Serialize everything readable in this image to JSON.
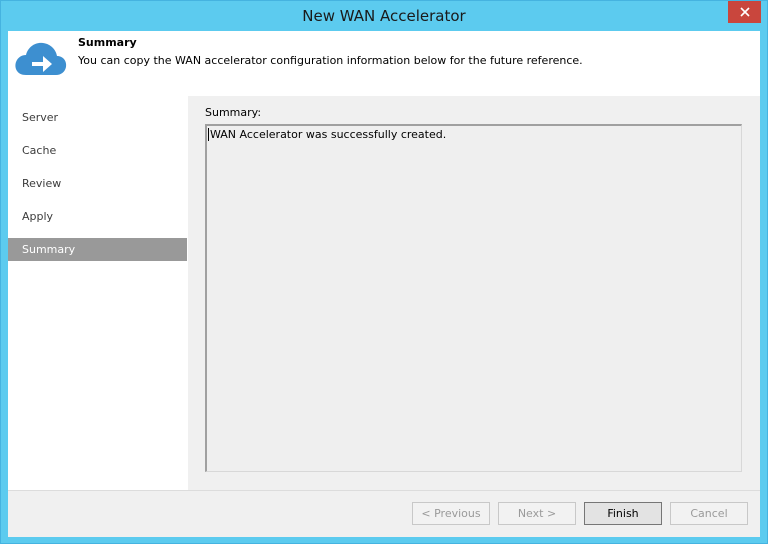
{
  "window": {
    "title": "New WAN Accelerator"
  },
  "header": {
    "icon": "cloud-arrow-icon",
    "title": "Summary",
    "description": "You can copy the WAN accelerator configuration information below for the future reference."
  },
  "nav": {
    "items": [
      {
        "label": "Server"
      },
      {
        "label": "Cache"
      },
      {
        "label": "Review"
      },
      {
        "label": "Apply"
      },
      {
        "label": "Summary",
        "active": true
      }
    ]
  },
  "content": {
    "summary_label": "Summary:",
    "summary_text": "WAN Accelerator was successfully created."
  },
  "buttons": {
    "previous": "< Previous",
    "next": "Next >",
    "finish": "Finish",
    "cancel": "Cancel"
  },
  "colors": {
    "titlebar": "#5ccbef",
    "close": "#c9463d",
    "nav_active": "#999999",
    "icon_blue": "#3d8fd0"
  }
}
